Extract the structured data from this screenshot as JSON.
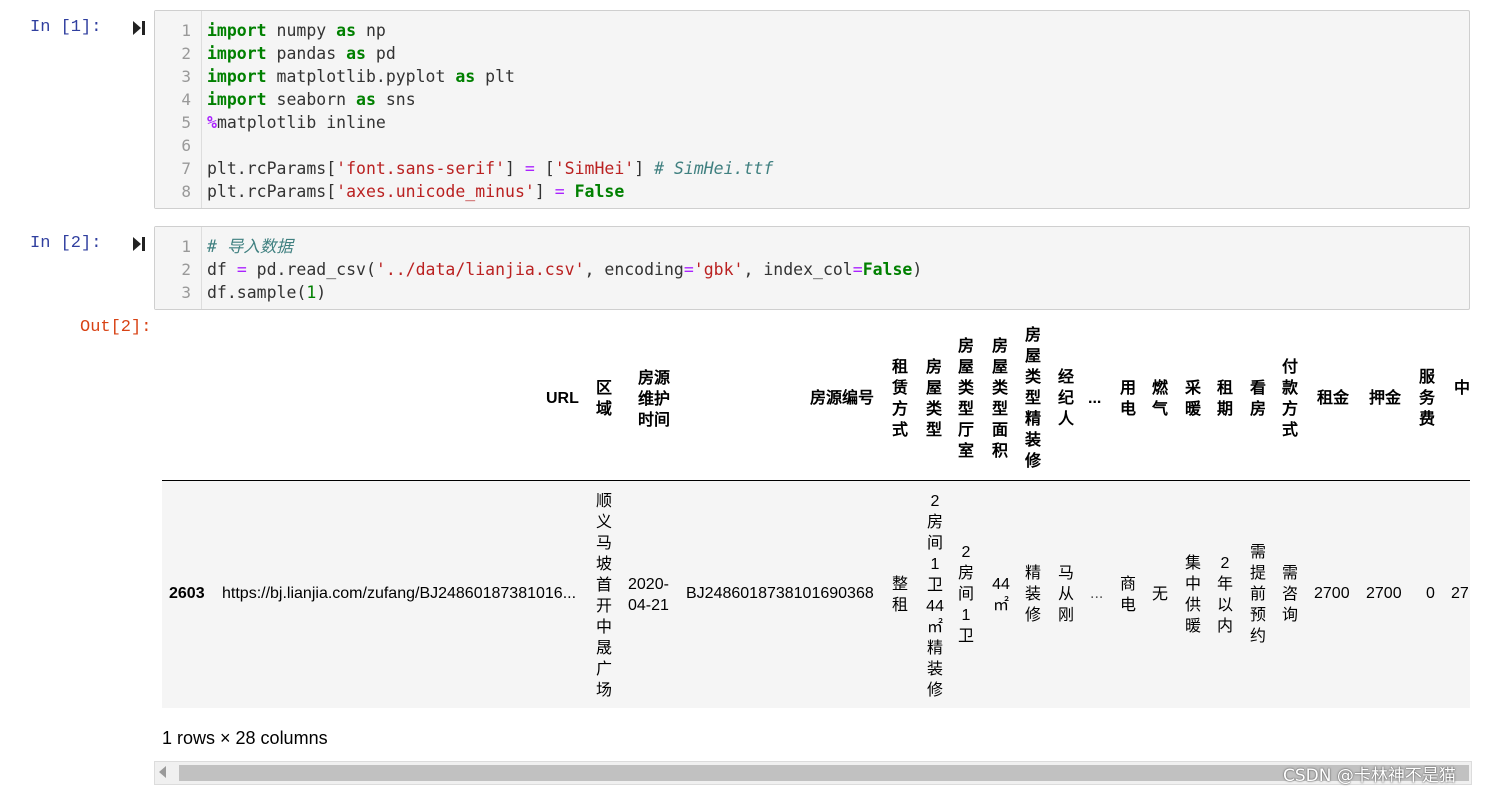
{
  "cells": [
    {
      "prompt": "In  [1]:",
      "line_numbers": [
        "1",
        "2",
        "3",
        "4",
        "5",
        "6",
        "7",
        "8"
      ]
    },
    {
      "prompt": "In  [2]:",
      "line_numbers": [
        "1",
        "2",
        "3"
      ]
    }
  ],
  "code1": {
    "l1": {
      "kw1": "import",
      "t1": " numpy ",
      "kw2": "as",
      "t2": " np"
    },
    "l2": {
      "kw1": "import",
      "t1": " pandas ",
      "kw2": "as",
      "t2": " pd"
    },
    "l3": {
      "kw1": "import",
      "t1": " matplotlib.pyplot ",
      "kw2": "as",
      "t2": " plt"
    },
    "l4": {
      "kw1": "import",
      "t1": " seaborn ",
      "kw2": "as",
      "t2": " sns"
    },
    "l5": {
      "magic": "%",
      "t1": "matplotlib inline"
    },
    "l7": {
      "t1": "plt.rcParams[",
      "s1": "'font.sans-serif'",
      "t2": "] ",
      "op": "=",
      "t3": " [",
      "s2": "'SimHei'",
      "t4": "] ",
      "cm": "# SimHei.ttf"
    },
    "l8": {
      "t1": "plt.rcParams[",
      "s1": "'axes.unicode_minus'",
      "t2": "] ",
      "op": "=",
      "t3": " ",
      "kw": "False"
    }
  },
  "code2": {
    "l1": {
      "cm": "# 导入数据"
    },
    "l2": {
      "t1": "df ",
      "op": "=",
      "t2": " pd.read_csv(",
      "s1": "'../data/lianjia.csv'",
      "t3": ", encoding",
      "op2": "=",
      "s2": "'gbk'",
      "t4": ", index_col",
      "op3": "=",
      "kw": "False",
      "t5": ")"
    },
    "l3": {
      "t1": "df.sample(",
      "n": "1",
      "t2": ")"
    }
  },
  "output": {
    "prompt": "Out[2]:",
    "headers": {
      "url": "URL",
      "district": "区域",
      "maint": "房源维护时间",
      "code": "房源编号",
      "lease": "租赁方式",
      "type": "房屋类型",
      "room": "房屋类型厅室",
      "area": "房屋类型面积",
      "decor": "房屋类型精装修",
      "agent": "经纪人",
      "ellipsis": "...",
      "power": "用电",
      "gas": "燃气",
      "heat": "采暖",
      "term": "租期",
      "viewing": "看房",
      "pay": "付款方式",
      "rent": "租金",
      "deposit": "押金",
      "fee": "服务费",
      "mid": "中"
    },
    "row": {
      "index": "2603",
      "url": "https://bj.lianjia.com/zufang/BJ24860187381016...",
      "district": "顺义马坡首开中晟广场",
      "date1": "2020-",
      "date2": "04-21",
      "code": "BJ2486018738101690368",
      "lease": "整租",
      "type_a": "2房间1卫44",
      "type_b": "㎡",
      "type_c": "精装修",
      "room": "2房间1卫",
      "area_n": "44",
      "area_u": "㎡",
      "decor": "精装修",
      "agent": "马从刚",
      "ellipsis": "...",
      "power": "商电",
      "gas": "无",
      "heat": "集中供暖",
      "term_n": "2",
      "term_t": "年以内",
      "viewing": "需提前预约",
      "pay": "需咨询",
      "rent": "2700",
      "deposit": "2700",
      "fee": "0",
      "mid": "27"
    },
    "summary": "1 rows × 28 columns"
  },
  "watermark": "CSDN @卡林神不是猫"
}
